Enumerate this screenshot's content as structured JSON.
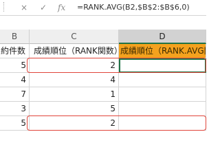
{
  "formula_bar": {
    "cancel_icon": "×",
    "enter_icon": "✓",
    "function_icon": "fx",
    "formula": "=RANK.AVG(B2,$B$2:$B$6,0)"
  },
  "columns": [
    {
      "label": "B"
    },
    {
      "label": "C"
    },
    {
      "label": "D"
    }
  ],
  "table": {
    "header": {
      "b": "約件数",
      "c": "成績順位（RANK関数）",
      "d": "成績順位（RANK.AVG関"
    },
    "rows": [
      {
        "b": "5",
        "c": "2",
        "d": ""
      },
      {
        "b": "4",
        "c": "4",
        "d": ""
      },
      {
        "b": "7",
        "c": "1",
        "d": ""
      },
      {
        "b": "3",
        "c": "5",
        "d": ""
      },
      {
        "b": "5",
        "c": "2",
        "d": ""
      }
    ]
  },
  "colors": {
    "orange_header": "#f4a21e",
    "selection": "#217346",
    "highlight_box": "#e0443a"
  }
}
